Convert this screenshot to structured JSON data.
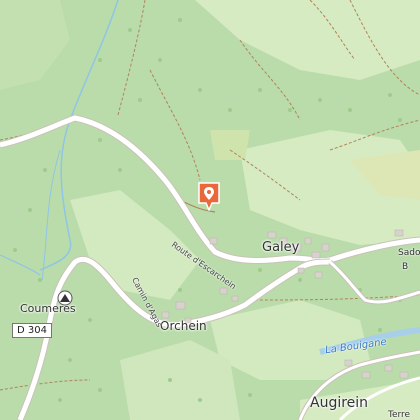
{
  "map": {
    "colors": {
      "forest": "#b9dcaa",
      "meadow": "#d8ecc4",
      "scrub": "#c8dfa6",
      "road": "#ffffff",
      "road_edge": "#c9c2b8",
      "track": "#b0845a",
      "stream": "#8fc5e6",
      "river": "#a7cfea",
      "marker": "#e8673b"
    },
    "places": {
      "galey": "Galey",
      "orchein": "Orchein",
      "coumeres": "Coumeres",
      "augirein": "Augirein",
      "sado": "Sado",
      "b": "B",
      "terre": "Terre"
    },
    "roads": {
      "route_escarchein": "Route d'Escarchein",
      "camin_agas": "Camin d'Agas",
      "d304": "D 304",
      "river_label": "La Bouigane"
    },
    "icons": {
      "location_marker": "map-pin-icon",
      "summit": "summit-icon"
    }
  }
}
